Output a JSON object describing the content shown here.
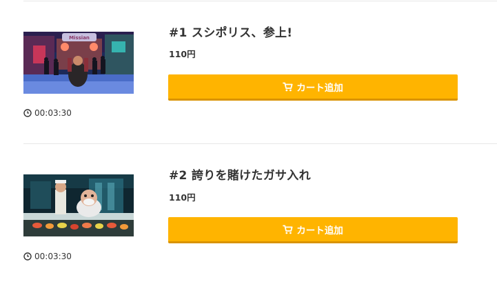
{
  "episodes": [
    {
      "title": "#1 スシポリス、参上!",
      "price": "110円",
      "cart_label": "カート追加",
      "duration": "00:03:30",
      "thumbnail_sign": "Missian"
    },
    {
      "title": "#2 誇りを賭けたガサ入れ",
      "price": "110円",
      "cart_label": "カート追加",
      "duration": "00:03:30"
    }
  ],
  "colors": {
    "cart_button": "#ffb400",
    "cart_button_shadow": "#d99300",
    "divider": "#e6e6e6",
    "text": "#333333"
  },
  "icons": {
    "cart": "cart-icon",
    "clock": "clock-icon"
  }
}
